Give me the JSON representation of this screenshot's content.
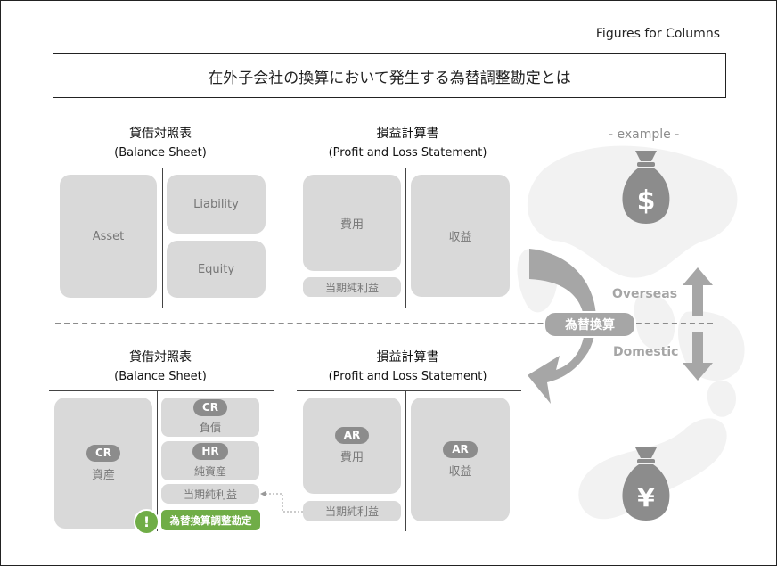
{
  "figure_label": "Figures for Columns",
  "title": "在外子会社の換算において発生する為替調整勘定とは",
  "top": {
    "bs": {
      "heading": "貸借対照表",
      "subheading": "(Balance Sheet)",
      "asset": "Asset",
      "liability": "Liability",
      "equity": "Equity"
    },
    "pl": {
      "heading": "損益計算書",
      "subheading": "(Profit and Loss Statement)",
      "expense": "費用",
      "net_income": "当期純利益",
      "revenue": "収益"
    }
  },
  "bottom": {
    "bs": {
      "heading": "貸借対照表",
      "subheading": "(Balance Sheet)",
      "asset_badge": "CR",
      "asset": "資産",
      "liability_badge": "CR",
      "liability": "負債",
      "net_assets_badge": "HR",
      "net_assets": "純資産",
      "net_income": "当期純利益",
      "fx_adjustment": "為替換算調整勘定",
      "alert_glyph": "!"
    },
    "pl": {
      "heading": "損益計算書",
      "subheading": "(Profit and Loss Statement)",
      "expense_badge": "AR",
      "expense": "費用",
      "net_income": "当期純利益",
      "revenue_badge": "AR",
      "revenue": "収益"
    }
  },
  "center": {
    "conversion": "為替換算",
    "overseas": "Overseas",
    "domestic": "Domestic"
  },
  "example": {
    "label": "- example -",
    "dollar_symbol": "$",
    "yen_symbol": "¥"
  },
  "colors": {
    "box": "#d9d9d9",
    "badge": "#8c8c8c",
    "accent_green": "#70ad47",
    "arrow": "#a6a6a6"
  }
}
